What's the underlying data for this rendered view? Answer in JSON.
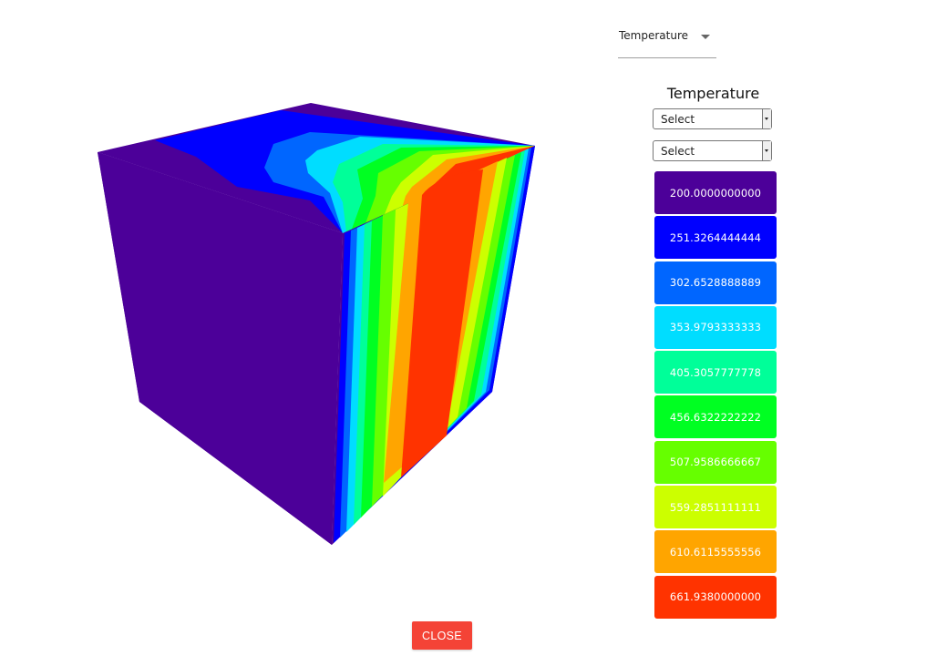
{
  "property_select": {
    "value": "Temperature",
    "icon": "caret-down-icon"
  },
  "legend": {
    "title": "Temperature",
    "select_1": "Select",
    "select_2": "Select",
    "items": [
      {
        "label": "200.0000000000",
        "color": "#4c0099"
      },
      {
        "label": "251.3264444444",
        "color": "#0000ff"
      },
      {
        "label": "302.6528888889",
        "color": "#0066ff"
      },
      {
        "label": "353.9793333333",
        "color": "#00ddff"
      },
      {
        "label": "405.3057777778",
        "color": "#00ff99"
      },
      {
        "label": "456.6322222222",
        "color": "#00ff22"
      },
      {
        "label": "507.9586666667",
        "color": "#66ff00"
      },
      {
        "label": "559.2851111111",
        "color": "#ccff00"
      },
      {
        "label": "610.6115555556",
        "color": "#ffa500"
      },
      {
        "label": "661.9380000000",
        "color": "#ff3300"
      }
    ]
  },
  "close_button": {
    "label": "CLOSE",
    "color": "#f44336"
  }
}
